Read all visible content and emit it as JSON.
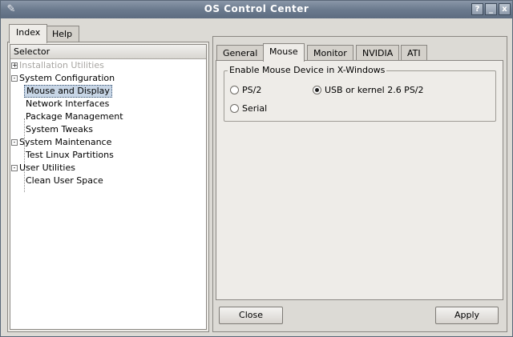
{
  "window": {
    "title": "OS Control Center",
    "app_icon": "wrench-icon",
    "buttons": {
      "help": "?",
      "minimize": "_",
      "close": "x"
    }
  },
  "left_tabs": [
    {
      "label": "Index",
      "active": true
    },
    {
      "label": "Help",
      "active": false
    }
  ],
  "tree": {
    "header": "Selector",
    "items": [
      {
        "label": "Installation Utilities",
        "level": 0,
        "expander": "+",
        "disabled": true
      },
      {
        "label": "System Configuration",
        "level": 0,
        "expander": "-"
      },
      {
        "label": "Mouse and Display",
        "level": 1,
        "selected": true
      },
      {
        "label": "Network Interfaces",
        "level": 1
      },
      {
        "label": "Package Management",
        "level": 1
      },
      {
        "label": "System Tweaks",
        "level": 1
      },
      {
        "label": "System Maintenance",
        "level": 0,
        "expander": "-"
      },
      {
        "label": "Test Linux Partitions",
        "level": 1
      },
      {
        "label": "User Utilities",
        "level": 0,
        "expander": "-"
      },
      {
        "label": "Clean User Space",
        "level": 1
      }
    ]
  },
  "right_tabs": [
    {
      "label": "General",
      "active": false
    },
    {
      "label": "Mouse",
      "active": true
    },
    {
      "label": "Monitor",
      "active": false
    },
    {
      "label": "NVIDIA",
      "active": false
    },
    {
      "label": "ATI",
      "active": false
    }
  ],
  "mouse": {
    "group_title": "Enable Mouse Device in X-Windows",
    "options": [
      {
        "label": "PS/2",
        "checked": false
      },
      {
        "label": "USB or kernel 2.6 PS/2",
        "checked": true
      },
      {
        "label": "Serial",
        "checked": false
      }
    ]
  },
  "footer": {
    "close_label": "Close",
    "apply_label": "Apply"
  },
  "colors": {
    "titlebar": "#6b7a8e",
    "selection": "#c8d6e6",
    "background": "#dcdad5"
  }
}
